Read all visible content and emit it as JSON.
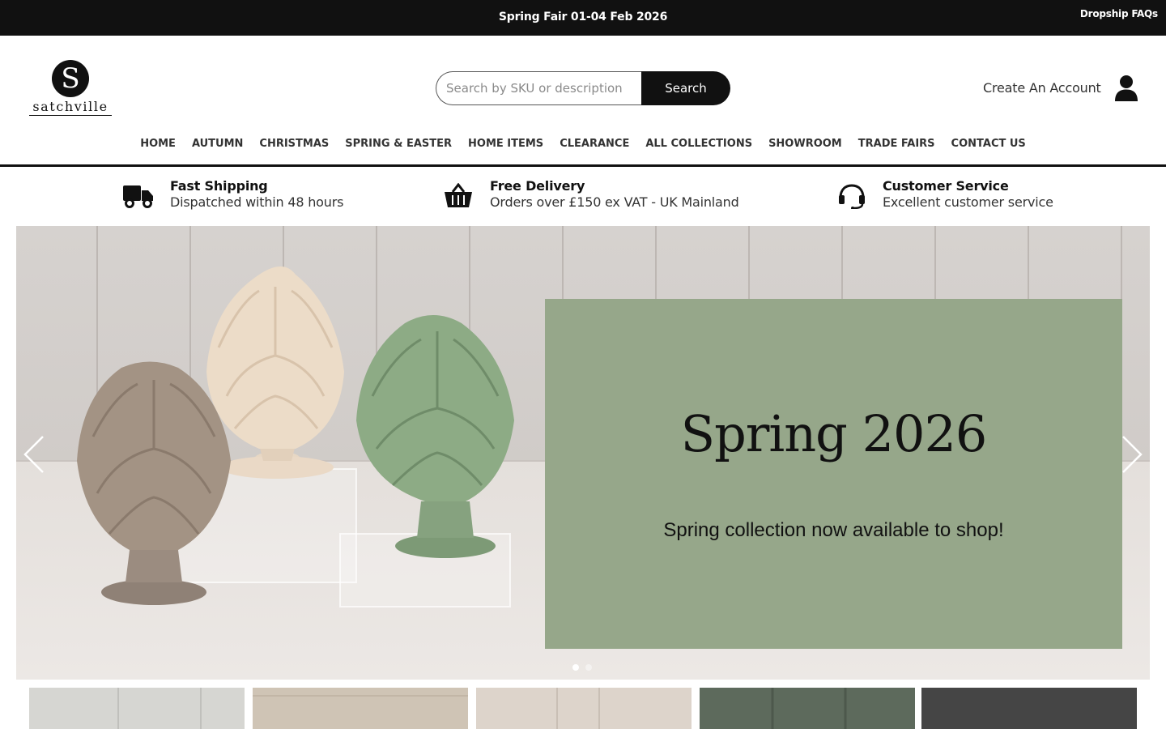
{
  "topbar": {
    "announcement": "Spring Fair 01-04 Feb 2026",
    "dropship_faqs": "Dropship FAQs",
    "background": "#111111"
  },
  "header": {
    "logo_letter": "S",
    "logo_text": "satchville",
    "search": {
      "placeholder": "Search by SKU or description",
      "value": "",
      "button_label": "Search"
    },
    "create_account": "Create An Account",
    "user_icon": "user-icon"
  },
  "nav": {
    "items": [
      {
        "label": "HOME"
      },
      {
        "label": "AUTUMN"
      },
      {
        "label": "CHRISTMAS"
      },
      {
        "label": "SPRING & EASTER"
      },
      {
        "label": "HOME ITEMS"
      },
      {
        "label": "CLEARANCE"
      },
      {
        "label": "ALL COLLECTIONS"
      },
      {
        "label": "SHOWROOM"
      },
      {
        "label": "TRADE FAIRS"
      },
      {
        "label": "CONTACT US"
      }
    ]
  },
  "features": [
    {
      "icon": "truck-icon",
      "title": "Fast Shipping",
      "subtitle": "Dispatched within 48 hours"
    },
    {
      "icon": "basket-icon",
      "title": "Free Delivery",
      "subtitle": "Orders over £150 ex VAT - UK Mainland"
    },
    {
      "icon": "headset-icon",
      "title": "Customer Service",
      "subtitle": "Excellent customer service"
    }
  ],
  "hero": {
    "title": "Spring 2026",
    "subtitle": "Spring collection now available to shop!",
    "promo_color": "#96a78a",
    "slide_count": 2,
    "active_slide": 1
  },
  "colors": {
    "accent": "#111111",
    "promo_panel": "#96a78a"
  }
}
